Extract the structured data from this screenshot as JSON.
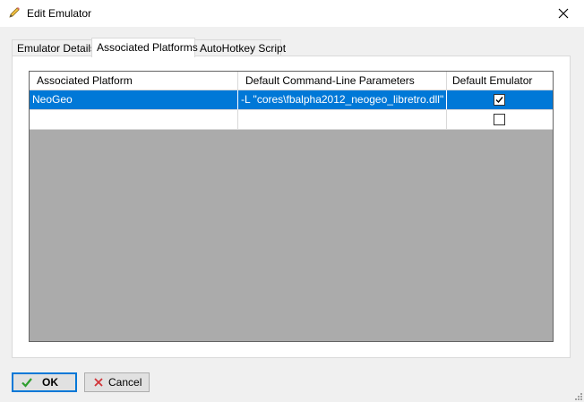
{
  "window": {
    "title": "Edit Emulator",
    "title_icon": "pencil-icon",
    "close_icon": "close-icon"
  },
  "tabs": [
    {
      "label": "Emulator Details",
      "active": false
    },
    {
      "label": "Associated Platforms",
      "active": true
    },
    {
      "label": "AutoHotkey Script",
      "active": false
    }
  ],
  "grid": {
    "columns": [
      "Associated Platform",
      "Default Command-Line Parameters",
      "Default Emulator"
    ],
    "rows": [
      {
        "platform": "NeoGeo",
        "parameters": "-L \"cores\\fbalpha2012_neogeo_libretro.dll\"",
        "default_emulator": true,
        "selected": true
      },
      {
        "platform": "",
        "parameters": "",
        "default_emulator": false,
        "selected": false
      }
    ]
  },
  "buttons": {
    "ok_label": "OK",
    "ok_icon": "checkmark-icon",
    "cancel_label": "Cancel",
    "cancel_icon": "x-icon"
  },
  "colors": {
    "selection": "#0078d7",
    "grid_background": "#ababab",
    "ok_icon": "#2e9e2e",
    "cancel_icon": "#d13438"
  }
}
